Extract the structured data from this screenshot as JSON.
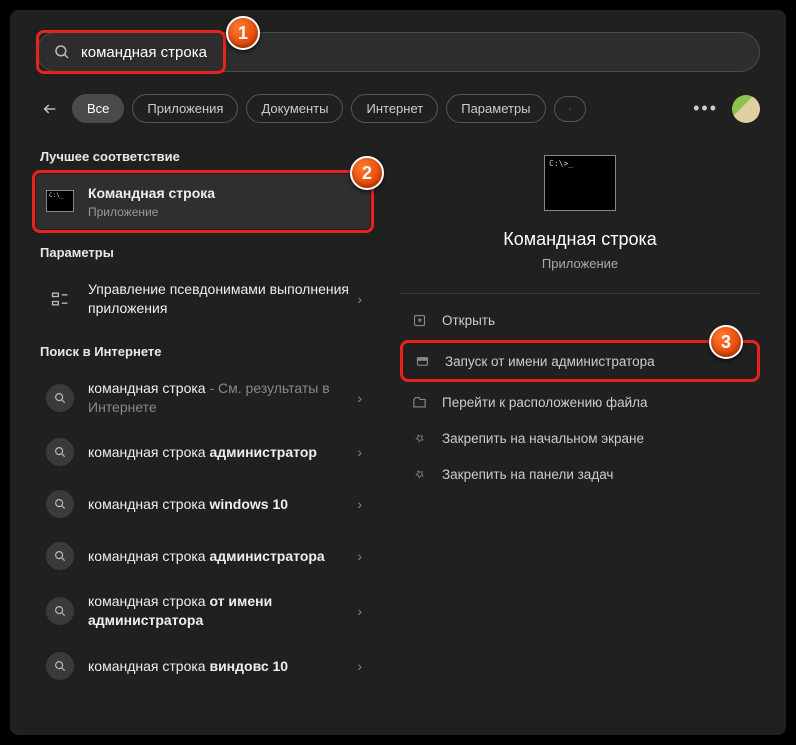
{
  "search": {
    "value": "командная строка"
  },
  "badges": {
    "b1": "1",
    "b2": "2",
    "b3": "3"
  },
  "tabs": {
    "all": "Все",
    "apps": "Приложения",
    "docs": "Документы",
    "web": "Интернет",
    "settings": "Параметры"
  },
  "sections": {
    "best": "Лучшее соответствие",
    "settings": "Параметры",
    "web": "Поиск в Интернете"
  },
  "best": {
    "title": "Командная строка",
    "subtitle": "Приложение"
  },
  "settings_items": [
    {
      "line1": "Управление псевдонимами выполнения приложения"
    }
  ],
  "web_items": [
    {
      "pre": "командная строка",
      "suffix_dim": " - См. результаты в Интернете",
      "bold": ""
    },
    {
      "pre": "командная строка ",
      "bold": "администратор"
    },
    {
      "pre": "командная строка ",
      "bold": "windows 10"
    },
    {
      "pre": "командная строка ",
      "bold": "администратора"
    },
    {
      "pre": "командная строка ",
      "bold": "от имени администратора"
    },
    {
      "pre": "командная строка ",
      "bold": "виндовс 10"
    }
  ],
  "preview": {
    "title": "Командная строка",
    "subtitle": "Приложение"
  },
  "actions": {
    "open": "Открыть",
    "run_admin": "Запуск от имени администратора",
    "open_location": "Перейти к расположению файла",
    "pin_start": "Закрепить на начальном экране",
    "pin_taskbar": "Закрепить на панели задач"
  }
}
